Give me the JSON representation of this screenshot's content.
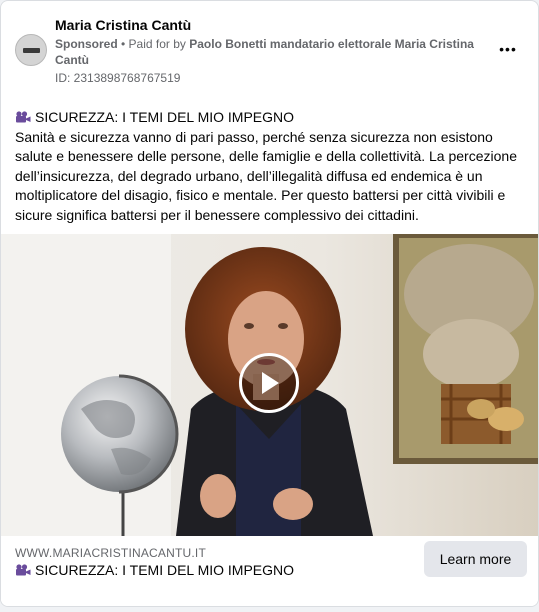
{
  "post": {
    "page_name": "Maria Cristina Cantù",
    "sponsored_label": "Sponsored",
    "paid_prefix": " • Paid for by ",
    "payer": "Paolo Bonetti mandatario elettorale Maria Cristina Cantù",
    "ad_id": "ID: 2313898768767519",
    "more_icon": "more-options-icon",
    "more_glyph": "•••"
  },
  "body": {
    "headline_icon": "video-camera-icon",
    "headline": "SICUREZZA: I TEMI DEL MIO IMPEGNO",
    "text": "Sanità e sicurezza vanno di pari passo, perché senza sicurezza non esistono salute e benessere delle persone, delle famiglie e della collettività. La percezione dell’insicurezza, del degrado urbano, dell’illegalità diffusa ed endemica è un moltiplicatore del disagio, fisico e mentale. Per questo battersi per città vivibili e sicure significa battersi per il benessere complessivo dei cittadini."
  },
  "media": {
    "type": "video",
    "play_icon": "play-icon"
  },
  "link": {
    "domain": "WWW.MARIACRISTINACANTU.IT",
    "title_icon": "video-camera-icon",
    "title": "SICUREZZA: I TEMI DEL MIO IMPEGNO",
    "cta_label": "Learn more"
  },
  "colors": {
    "secondary_text": "#65676b",
    "primary_text": "#050505",
    "button_bg": "#e4e6eb",
    "card_border": "#dadde1"
  }
}
